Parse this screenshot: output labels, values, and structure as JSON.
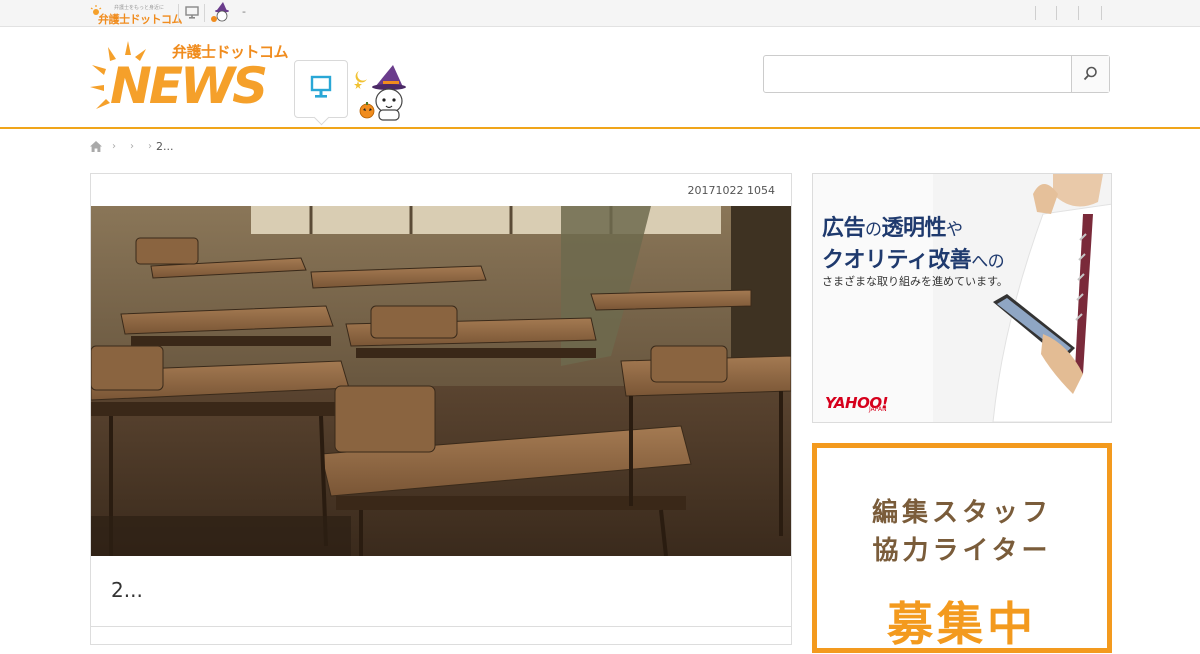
{
  "topbar": {
    "brand_tagline": "弁護士をもっと身近に",
    "brand_name": "弁護士ドットコム",
    "separator_text": "-"
  },
  "header": {
    "logo_jp": "弁護士ドットコム",
    "logo_news": "NEWS",
    "search": {
      "placeholder": "",
      "value": ""
    }
  },
  "breadcrumb": {
    "items": [
      "",
      "",
      "2..."
    ]
  },
  "article": {
    "date": "20171022 1054",
    "title": "2..."
  },
  "ads": {
    "yahoo": {
      "line1_a": "広告",
      "line1_b": "の",
      "line1_c": "透明性",
      "line1_d": "や",
      "line2_a": "クオリティ改善",
      "line2_b": "への",
      "line3": "さまざまな取り組みを進めています。",
      "logo": "YAHOO!",
      "logo_sub": "JAPAN"
    },
    "recruit": {
      "line1": "編集スタッフ",
      "line2": "協力ライター",
      "line3": "募集中"
    }
  },
  "colors": {
    "accent": "#f0a51a",
    "brand_orange": "#f08c1e",
    "ad_navy": "#1f3a6e",
    "yahoo_red": "#d6001c",
    "recruit_brown": "#7a5c3a"
  },
  "icons": {
    "home": "home-icon",
    "search": "search-icon",
    "pc": "pc-monitor-icon",
    "mascot": "halloween-mascot-icon"
  }
}
